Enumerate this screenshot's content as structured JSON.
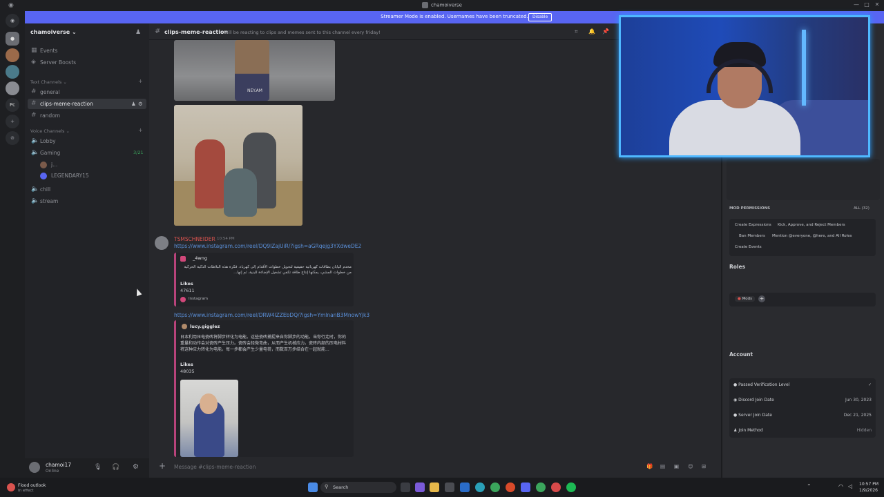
{
  "window": {
    "title": "chamoiverse"
  },
  "banner": {
    "message": "Streamer Mode is enabled. Usernames have been truncated.",
    "disable_label": "Disable"
  },
  "guilds": {
    "pc_label": "Pc"
  },
  "server": {
    "name": "chamoiverse",
    "top_items": [
      {
        "label": "Events"
      },
      {
        "label": "Server Boosts"
      }
    ],
    "text_category": "Text Channels",
    "text_channels": [
      {
        "label": "general"
      },
      {
        "label": "clips-meme-reaction"
      },
      {
        "label": "random"
      }
    ],
    "voice_category": "Voice Channels",
    "voice_channels": [
      {
        "label": "Lobby"
      },
      {
        "label": "Gaming",
        "count": "3/21"
      },
      {
        "label": "chill"
      },
      {
        "label": "stream"
      }
    ],
    "voice_users": [
      {
        "label": "j..."
      },
      {
        "label": "LEGENDARY15"
      }
    ]
  },
  "user": {
    "name": "chamoi17",
    "status": "Online"
  },
  "channel_header": {
    "name": "clips-meme-reaction",
    "topic": "Will be reacting to clips and memes sent to this channel every friday!"
  },
  "messages": {
    "media1_badge": "NEY.AM",
    "author": "TSMSCHNEIDER",
    "time": "10:54 PM",
    "link1": "https://www.instagram.com/reel/DQ9lZajUiR/?igsh=aGRqejg3YXdweDE2",
    "embed1": {
      "author": "_4wng",
      "text": "مخدم اليابان بطاقات كهربائية حقيقية لتحويل خطوات الأقدام إلى كهرباء. فكرة هذه البلاطات الذكية الحركية من خطوات المشي، يمكنها إنتاج طاقة تكفي تشغيل الإضاءة للبنية، ثم إنها...",
      "likes_label": "Likes",
      "likes": "47611",
      "footer": "Instagram"
    },
    "link2": "https://www.instagram.com/reel/DRW4lZZEbDQ/?igsh=YmlnanB3MnowYjk3",
    "embed2": {
      "author": "lucy.gigglez",
      "text": "日本利用压电瓷砖将脚步转化为电能。这些瓷砖捕捉来自你脚步的动能。当你行走时，你的重量和动作会对瓷砖产生压力。瓷砖会轻微弯曲，从而产生机械应力。瓷砖内部的压电材料将这种应力转化为电能。每一步都会产生少量电荷，而数百万步结合在一起就能...",
      "likes_label": "Likes",
      "likes": "48035"
    }
  },
  "composer": {
    "placeholder": "Message #clips-meme-reaction"
  },
  "right_panel": {
    "mod_permissions_label": "MOD PERMISSIONS",
    "all_label": "ALL (32)",
    "permissions": [
      "Create Expressions",
      "Kick, Approve, and Reject Members",
      "Ban Members",
      "Mention @everyone, @here, and All Roles",
      "Create Events"
    ],
    "roles_label": "Roles",
    "role": "Mods",
    "account_label": "Account",
    "account_rows": [
      {
        "label": "Passed Verification Level",
        "value": "✓"
      },
      {
        "label": "Discord Join Date",
        "value": "Jun 30, 2023"
      },
      {
        "label": "Server Join Date",
        "value": "Dec 21, 2025"
      },
      {
        "label": "Join Method",
        "value": "Hidden"
      }
    ]
  },
  "taskbar": {
    "weather_title": "Flood outlook",
    "weather_sub": "In effect",
    "search_label": "Search",
    "time": "10:57 PM",
    "date": "1/9/2026"
  },
  "colors": {
    "blurple": "#5865f2",
    "author": "#d9534f",
    "link": "#5a8fd8",
    "embed_border": "#b7437a"
  }
}
